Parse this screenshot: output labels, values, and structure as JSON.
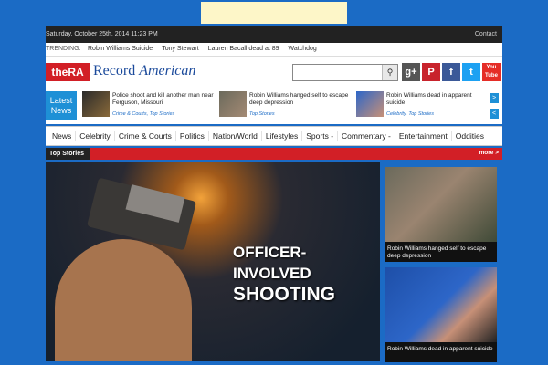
{
  "topbar": {
    "date": "Saturday, October 25th, 2014 11:23 PM",
    "contact": "Contact"
  },
  "trending": {
    "label": "TRENDING:",
    "items": [
      "Robin Williams Suicide",
      "Tony Stewart",
      "Lauren Bacall dead at 89",
      "Watchdog"
    ]
  },
  "brand": {
    "mark": "theRA",
    "name_a": "Record",
    "name_b": "American"
  },
  "search": {
    "placeholder": "",
    "button_icon": "search-icon"
  },
  "social": {
    "gplus": "g+",
    "pinterest": "P",
    "facebook": "f",
    "twitter": "t",
    "youtube": "You Tube"
  },
  "latest": {
    "label_line1": "Latest",
    "label_line2": "News",
    "items": [
      {
        "title": "Police shoot and kill another man near Ferguson, Missouri",
        "category": "Crime & Courts, Top Stories"
      },
      {
        "title": "Robin Williams hanged self to escape deep depression",
        "category": "Top Stories"
      },
      {
        "title": "Robin Williams dead in apparent suicide",
        "category": "Celebrity, Top Stories"
      }
    ],
    "next": ">",
    "prev": "<"
  },
  "nav": [
    "News",
    "Celebrity",
    "Crime & Courts",
    "Politics",
    "Nation/World",
    "Lifestyles",
    "Sports -",
    "Commentary -",
    "Entertainment",
    "Oddities"
  ],
  "top_stories": {
    "label": "Top Stories",
    "more": "more >"
  },
  "feature": {
    "line1": "OFFICER-INVOLVED",
    "line2": "SHOOTING"
  },
  "side": [
    {
      "caption": "Robin Williams hanged self to escape deep depression"
    },
    {
      "caption": "Robin Williams dead in apparent suicide"
    }
  ]
}
